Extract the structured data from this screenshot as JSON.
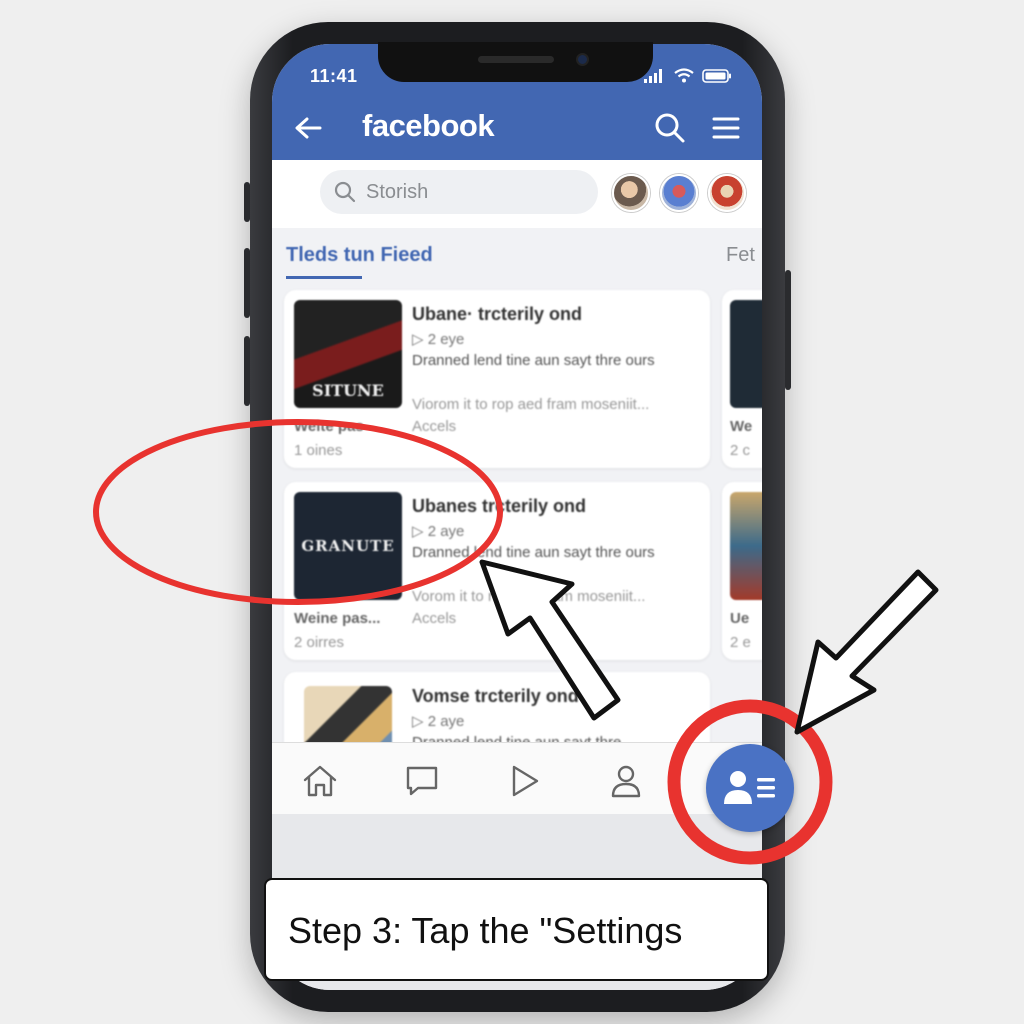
{
  "status_bar": {
    "time": "11:41"
  },
  "header": {
    "title": "facebook"
  },
  "search": {
    "placeholder": "Storish"
  },
  "tabs": {
    "active": "Tleds tun Fieed",
    "other": "Fet"
  },
  "cards": [
    {
      "thumb_text": "SITUNE",
      "title": "Ubane· trcterily ond",
      "meta": "▷ 2 eye",
      "desc": "Dranned lend tine aun sayt thre ours",
      "sub": "Viorom it to rop aed fram moseniit...",
      "sub2": "Accels",
      "foot_bold": "Weite pas",
      "foot": "1 oines"
    },
    {
      "thumb_text": "GRANUTE",
      "title": "Ubanes trcterily ond",
      "meta": "▷ 2 aye",
      "desc": "Dranned lend tine aun sayt thre ours",
      "sub": "Vorom it to rop aed fram moseniit...",
      "sub2": "Accels",
      "foot_bold": "Weine pas...",
      "foot": "2 oirres"
    },
    {
      "thumb_text": "",
      "title": "Vomse trcterily ond",
      "meta": "▷ 2 aye",
      "desc": "Dranned lend tine aun sayt thre",
      "sub": "",
      "sub2": "",
      "foot_bold": "",
      "foot": ""
    }
  ],
  "side_cards": [
    {
      "foot_bold": "We",
      "foot": "2 c"
    },
    {
      "foot_bold": "Ue",
      "foot": "2 e"
    }
  ],
  "bottom_nav": [
    "home-icon",
    "chat-icon",
    "play-icon",
    "profile-icon"
  ],
  "fab": {
    "icon": "settings-profile-list-icon"
  },
  "caption": {
    "text": "Step 3: Tap the \"Settings"
  },
  "colors": {
    "brand": "#4267b2",
    "highlight": "#e8332f",
    "fab": "#4a72c4"
  }
}
